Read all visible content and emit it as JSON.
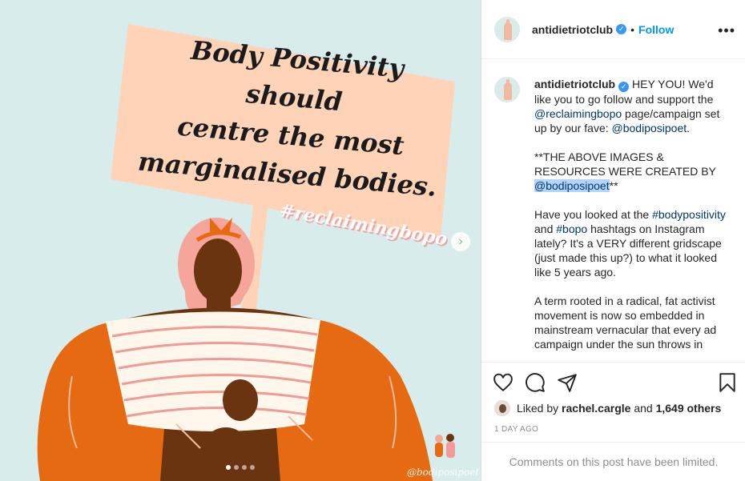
{
  "post": {
    "sign_lines": [
      "Body Positivity should",
      "centre the most",
      "marginalised bodies."
    ],
    "art_hashtag": "#reclaimingbopo",
    "watermark": "@bodiposipoet",
    "carousel_total": 4,
    "carousel_active": 1
  },
  "header": {
    "username": "antidietriotclub",
    "separator": "•",
    "follow_label": "Follow",
    "more_label": "•••"
  },
  "caption": {
    "username": "antidietriotclub",
    "p1": {
      "t1": "HEY YOU! We'd like you to go follow and support the ",
      "m1": "@reclaimingbopo",
      "t2": " page/campaign set up by our fave: ",
      "m2": "@bodiposipoet",
      "t3": "."
    },
    "p2": {
      "t1": "**THE ABOVE IMAGES & RESOURCES WERE CREATED BY ",
      "m1": "@bodiposipoet",
      "t2": "**"
    },
    "p3": {
      "t1": "Have you looked at the ",
      "h1": "#bodypositivity",
      "t2": " and ",
      "h2": "#bopo",
      "t3": " hashtags on Instagram lately? It's a VERY different gridscape (just made this up?) to what it looked like 5 years ago."
    },
    "p4": {
      "t1": "A term rooted in a radical, fat activist movement is now so embedded in mainstream vernacular that every ad campaign under the sun throws in"
    }
  },
  "likes": {
    "prefix": "Liked by",
    "user": "rachel.cargle",
    "and": "and",
    "others": "1,649 others"
  },
  "timestamp": "1 DAY AGO",
  "comments_notice": "Comments on this post have been limited.",
  "colors": {
    "link": "#00376b",
    "accent": "#0095f6",
    "sign": "#ffd3b8",
    "shirt_orange": "#e56a12",
    "skin": "#6b3410",
    "background": "#d9ecec"
  }
}
